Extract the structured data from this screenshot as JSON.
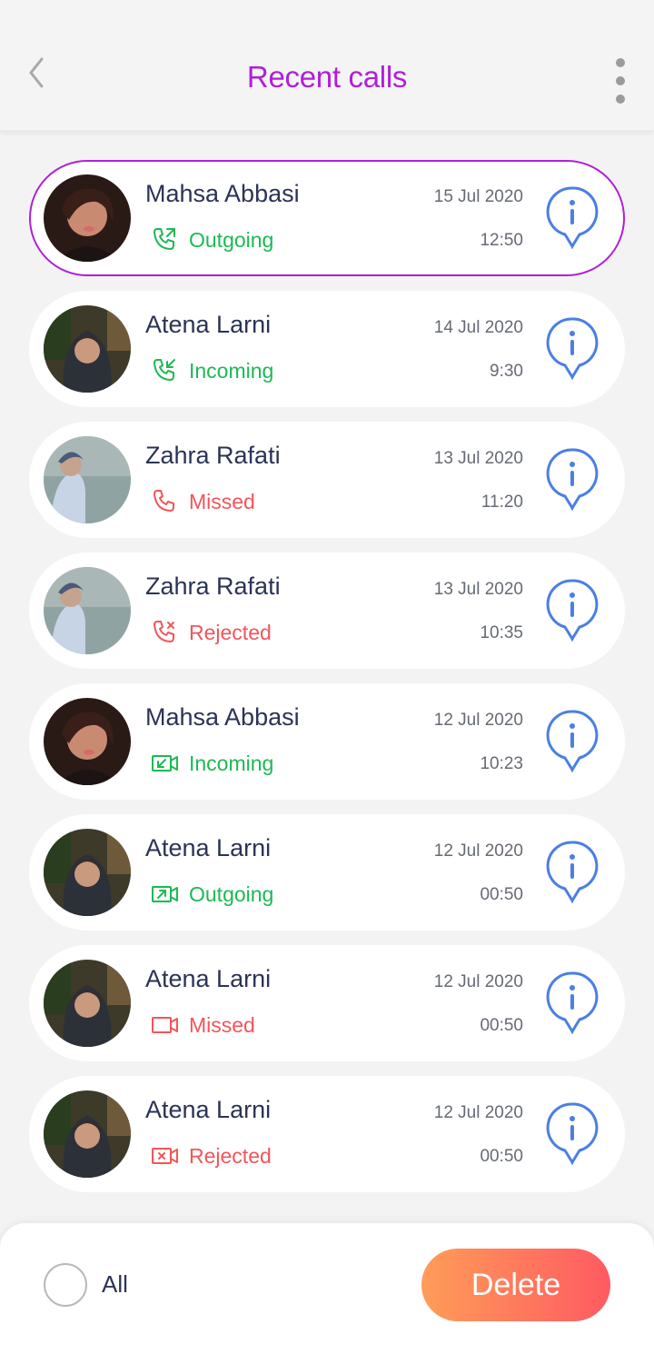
{
  "header": {
    "title": "Recent calls"
  },
  "colors": {
    "accent": "#b01fd8",
    "incoming_outgoing": "#1db954",
    "missed_rejected": "#f2555a",
    "info": "#4a7fe5",
    "delete_gradient": [
      "#ff9c58",
      "#ff5a61"
    ]
  },
  "calls": [
    {
      "name": "Mahsa Abbasi",
      "status": "Outgoing",
      "kind": "voice-outgoing",
      "date": "15 Jul 2020",
      "time": "12:50",
      "selected": true,
      "avatar": "mahsa"
    },
    {
      "name": "Atena Larni",
      "status": "Incoming",
      "kind": "voice-incoming",
      "date": "14 Jul 2020",
      "time": "9:30",
      "selected": false,
      "avatar": "atena"
    },
    {
      "name": "Zahra Rafati",
      "status": "Missed",
      "kind": "voice-missed",
      "date": "13 Jul 2020",
      "time": "11:20",
      "selected": false,
      "avatar": "zahra"
    },
    {
      "name": "Zahra Rafati",
      "status": "Rejected",
      "kind": "voice-rejected",
      "date": "13 Jul 2020",
      "time": "10:35",
      "selected": false,
      "avatar": "zahra"
    },
    {
      "name": "Mahsa Abbasi",
      "status": "Incoming",
      "kind": "video-incoming",
      "date": "12 Jul 2020",
      "time": "10:23",
      "selected": false,
      "avatar": "mahsa"
    },
    {
      "name": "Atena Larni",
      "status": "Outgoing",
      "kind": "video-outgoing",
      "date": "12 Jul 2020",
      "time": "00:50",
      "selected": false,
      "avatar": "atena"
    },
    {
      "name": "Atena Larni",
      "status": "Missed",
      "kind": "video-missed",
      "date": "12 Jul 2020",
      "time": "00:50",
      "selected": false,
      "avatar": "atena"
    },
    {
      "name": "Atena Larni",
      "status": "Rejected",
      "kind": "video-rejected",
      "date": "12 Jul 2020",
      "time": "00:50",
      "selected": false,
      "avatar": "atena"
    }
  ],
  "footer": {
    "select_all_label": "All",
    "delete_label": "Delete"
  }
}
